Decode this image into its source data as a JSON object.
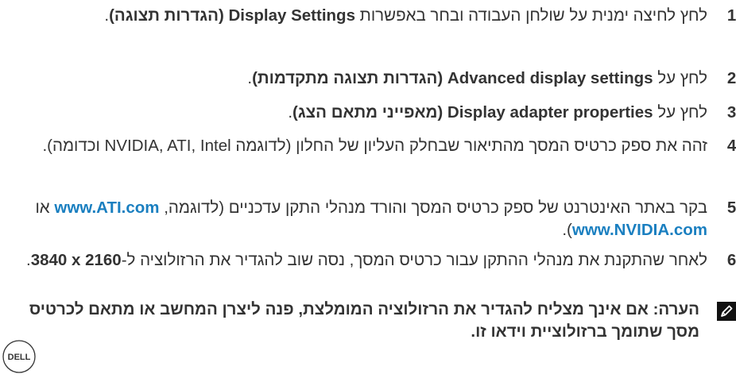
{
  "steps": [
    {
      "number": "1.",
      "segments": [
        {
          "text": "לחץ לחיצה ימנית על שולחן העבודה ובחר באפשרות ",
          "style": "normal"
        },
        {
          "text": "Display Settings (הגדרות תצוגה)",
          "style": "bold"
        },
        {
          "text": ".",
          "style": "normal"
        }
      ]
    },
    {
      "number": "2.",
      "segments": [
        {
          "text": "לחץ על ",
          "style": "normal"
        },
        {
          "text": "Advanced display settings (הגדרות תצוגה מתקדמות)",
          "style": "bold"
        },
        {
          "text": ".",
          "style": "normal"
        }
      ]
    },
    {
      "number": "3.",
      "segments": [
        {
          "text": "לחץ על ",
          "style": "normal"
        },
        {
          "text": "Display adapter properties (מאפייני מתאם הצג)",
          "style": "bold"
        },
        {
          "text": ".",
          "style": "normal"
        }
      ]
    },
    {
      "number": "4.",
      "segments": [
        {
          "text": "זהה את ספק כרטיס המסך מהתיאור שבחלק העליון של החלון (לדוגמה NVIDIA, ATI, Intel וכדומה).",
          "style": "normal"
        }
      ]
    },
    {
      "number": "5.",
      "segments": [
        {
          "text": "בקר באתר האינטרנט של ספק כרטיס המסך והורד מנהלי התקן עדכניים (לדוגמה, ",
          "style": "normal"
        },
        {
          "text": "www.ATI.com",
          "style": "link"
        },
        {
          "text": " או ",
          "style": "normal"
        },
        {
          "text": "www.NVIDIA.com",
          "style": "link"
        },
        {
          "text": ").",
          "style": "normal"
        }
      ]
    },
    {
      "number": "6.",
      "segments": [
        {
          "text": "לאחר שהתקנת את מנהלי ההתקן עבור כרטיס המסך, נסה שוב להגדיר את הרזולוציה ל-",
          "style": "normal"
        },
        {
          "text": "3840 x 2160",
          "style": "bold"
        },
        {
          "text": ".",
          "style": "normal"
        }
      ]
    }
  ],
  "note": {
    "icon": "pencil-note-icon",
    "text": "הערה: אם אינך מצליח להגדיר את הרזולוציה המומלצת, פנה ליצרן המחשב או מתאם לכרטיס מסך שתומך ברזולוציית וידאו זו."
  },
  "logo": {
    "icon": "dell-logo",
    "text": "DELL"
  },
  "colors": {
    "text": "#333333",
    "link": "#1a7fc0"
  }
}
